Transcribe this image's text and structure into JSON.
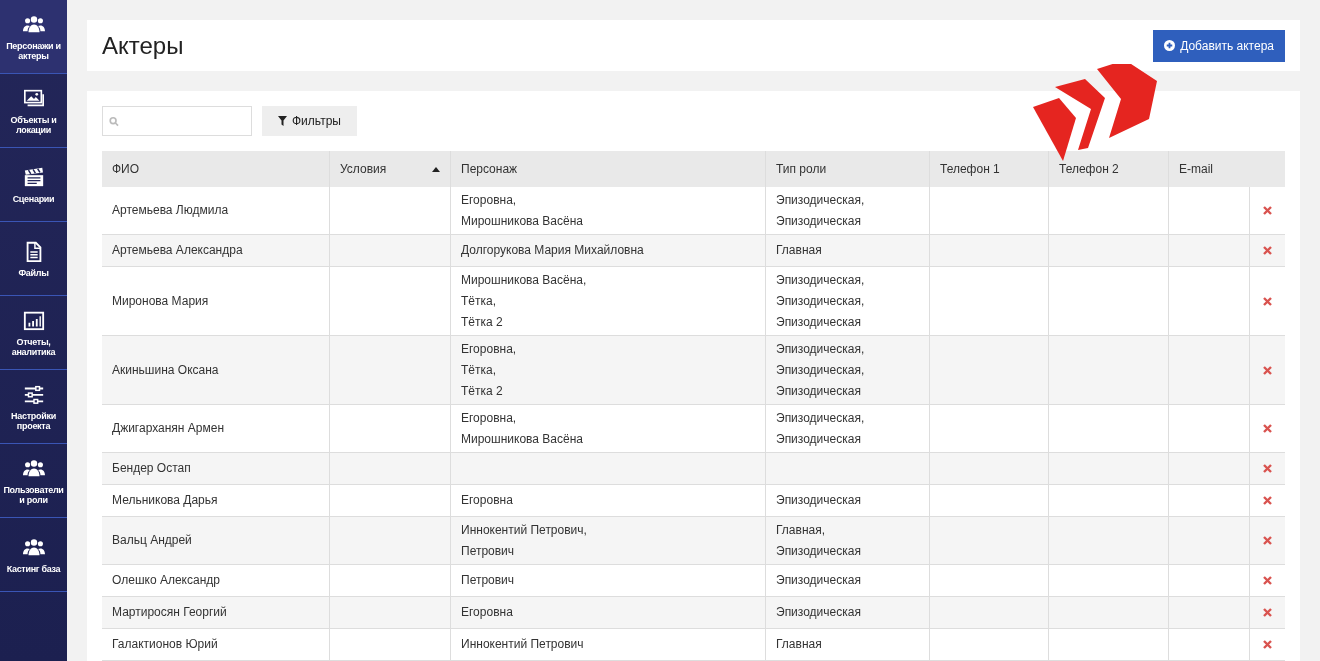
{
  "sidebar": {
    "items": [
      {
        "label": "Персонажи и актеры",
        "selected": true
      },
      {
        "label": "Объекты и локации",
        "selected": false
      },
      {
        "label": "Сценарии",
        "selected": false
      },
      {
        "label": "Файлы",
        "selected": false
      },
      {
        "label": "Отчеты, аналитика",
        "selected": false
      },
      {
        "label": "Настройки проекта",
        "selected": false
      },
      {
        "label": "Пользователи и роли",
        "selected": false
      },
      {
        "label": "Кастинг база",
        "selected": false
      }
    ]
  },
  "header": {
    "title": "Актеры",
    "add_button": "Добавить актера"
  },
  "toolbar": {
    "filters_button": "Фильтры"
  },
  "table": {
    "columns": [
      {
        "label": "ФИО",
        "sorted": false
      },
      {
        "label": "Условия",
        "sorted": true
      },
      {
        "label": "Персонаж",
        "sorted": false
      },
      {
        "label": "Тип роли",
        "sorted": false
      },
      {
        "label": "Телефон 1",
        "sorted": false
      },
      {
        "label": "Телефон 2",
        "sorted": false
      },
      {
        "label": "E-mail",
        "sorted": false
      }
    ],
    "rows": [
      {
        "name": "Артемьева Людмила",
        "characters": [
          "Егоровна,",
          "Мирошникова Васёна"
        ],
        "roles": [
          "Эпизодическая,",
          "Эпизодическая"
        ]
      },
      {
        "name": "Артемьева Александра",
        "characters": [
          "Долгорукова Мария Михайловна"
        ],
        "roles": [
          "Главная"
        ]
      },
      {
        "name": "Миронова Мария",
        "characters": [
          "Мирошникова Васёна,",
          "Тётка,",
          "Тётка 2"
        ],
        "roles": [
          "Эпизодическая,",
          "Эпизодическая,",
          "Эпизодическая"
        ]
      },
      {
        "name": "Акиньшина Оксана",
        "characters": [
          "Егоровна,",
          "Тётка,",
          "Тётка 2"
        ],
        "roles": [
          "Эпизодическая,",
          "Эпизодическая,",
          "Эпизодическая"
        ]
      },
      {
        "name": "Джигарханян Армен",
        "characters": [
          "Егоровна,",
          "Мирошникова Васёна"
        ],
        "roles": [
          "Эпизодическая,",
          "Эпизодическая"
        ]
      },
      {
        "name": "Бендер Остап",
        "characters": [],
        "roles": []
      },
      {
        "name": "Мельникова Дарья",
        "characters": [
          "Егоровна"
        ],
        "roles": [
          "Эпизодическая"
        ]
      },
      {
        "name": "Вальц Андрей",
        "characters": [
          "Иннокентий Петрович,",
          "Петрович"
        ],
        "roles": [
          "Главная,",
          "Эпизодическая"
        ]
      },
      {
        "name": "Олешко Александр",
        "characters": [
          "Петрович"
        ],
        "roles": [
          "Эпизодическая"
        ]
      },
      {
        "name": "Мартиросян Георгий",
        "characters": [
          "Егоровна"
        ],
        "roles": [
          "Эпизодическая"
        ]
      },
      {
        "name": "Галактионов Юрий",
        "characters": [
          "Иннокентий Петрович"
        ],
        "roles": [
          "Главная"
        ]
      }
    ]
  }
}
